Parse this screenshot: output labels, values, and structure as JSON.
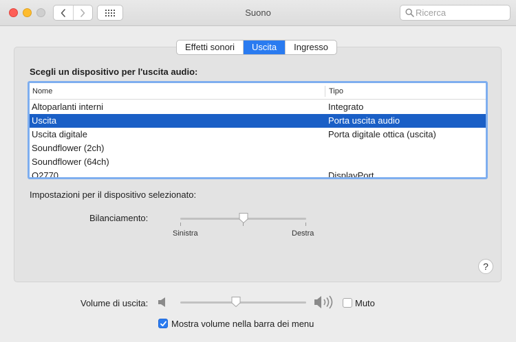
{
  "window": {
    "title": "Suono"
  },
  "search": {
    "placeholder": "Ricerca"
  },
  "tabs": [
    {
      "label": "Effetti sonori",
      "active": false
    },
    {
      "label": "Uscita",
      "active": true
    },
    {
      "label": "Ingresso",
      "active": false
    }
  ],
  "output": {
    "heading": "Scegli un dispositivo per l'uscita audio:",
    "columns": [
      "Nome",
      "Tipo"
    ],
    "rows": [
      {
        "name": "Altoparlanti interni",
        "type": "Integrato",
        "selected": false
      },
      {
        "name": "Uscita",
        "type": "Porta uscita audio",
        "selected": true
      },
      {
        "name": "Uscita digitale",
        "type": "Porta digitale ottica (uscita)",
        "selected": false
      },
      {
        "name": "Soundflower (2ch)",
        "type": "",
        "selected": false
      },
      {
        "name": "Soundflower (64ch)",
        "type": "",
        "selected": false
      },
      {
        "name": "Q2770",
        "type": "DisplayPort",
        "selected": false
      }
    ],
    "settings_heading": "Impostazioni per il dispositivo selezionato:",
    "balance": {
      "label": "Bilanciamento:",
      "left": "Sinistra",
      "right": "Destra",
      "value": 0.5
    }
  },
  "help": {
    "glyph": "?"
  },
  "volume": {
    "label": "Volume di uscita:",
    "level": 0.44,
    "mute_label": "Muto",
    "muted": false,
    "show_in_menubar_label": "Mostra volume nella barra dei menu",
    "show_in_menubar": true
  },
  "colors": {
    "accent": "#2a7bf0",
    "selection": "#1a5fc6",
    "table_focus": "#7eaeef"
  },
  "icons": [
    "back-icon",
    "forward-icon",
    "grid-icon",
    "search-icon",
    "speaker-low-icon",
    "speaker-high-icon",
    "checkmark-icon",
    "help-icon"
  ]
}
